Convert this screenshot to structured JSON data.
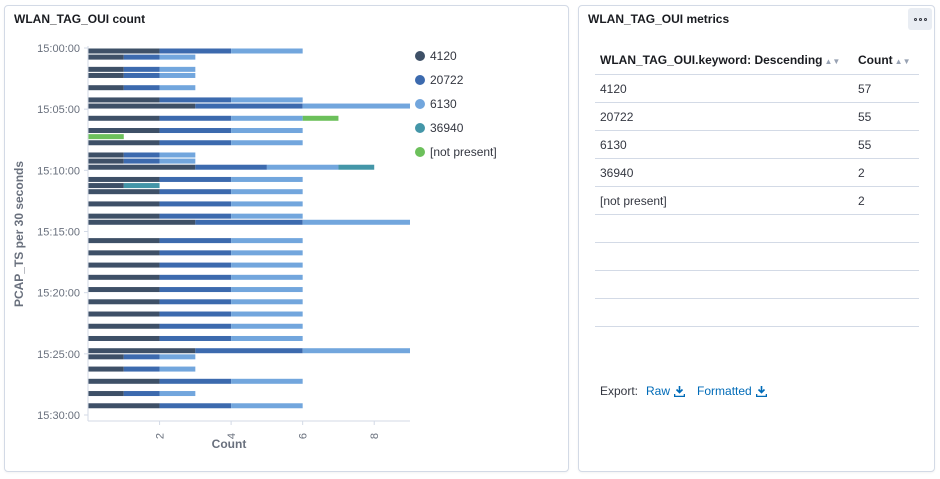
{
  "chart_panel": {
    "title": "WLAN_TAG_OUI count"
  },
  "metrics_panel": {
    "title": "WLAN_TAG_OUI metrics",
    "columns": [
      "WLAN_TAG_OUI.keyword: Descending",
      "Count"
    ],
    "rows": [
      [
        "4120",
        "57"
      ],
      [
        "20722",
        "55"
      ],
      [
        "6130",
        "55"
      ],
      [
        "36940",
        "2"
      ],
      [
        "[not present]",
        "2"
      ],
      [
        "",
        ""
      ],
      [
        "",
        ""
      ],
      [
        "",
        ""
      ],
      [
        "",
        ""
      ]
    ],
    "export_label": "Export:",
    "export_raw": "Raw",
    "export_formatted": "Formatted"
  },
  "colors": {
    "4120": "#3e5067",
    "20722": "#3c6aae",
    "6130": "#72a6dd",
    "36940": "#4496a8",
    "[not present]": "#6cc05b",
    "link": "#006bb8"
  },
  "chart_data": {
    "type": "bar",
    "orientation": "horizontal",
    "stacked": true,
    "xlabel": "Count",
    "ylabel": "PCAP_TS per 30 seconds",
    "xlim": [
      0,
      9
    ],
    "xticks": [
      "2",
      "4",
      "6",
      "8"
    ],
    "yticks": [
      "15:00:00",
      "15:05:00",
      "15:10:00",
      "15:15:00",
      "15:20:00",
      "15:25:00",
      "15:30:00"
    ],
    "legend": {
      "position": "right",
      "items": [
        "4120",
        "20722",
        "6130",
        "36940",
        "[not present]"
      ]
    },
    "grid": false,
    "series_order": [
      "4120",
      "20722",
      "6130",
      "36940",
      "[not present]"
    ],
    "bars": [
      {
        "t": "15:00:00",
        "values": [
          2,
          2,
          2,
          0,
          0
        ]
      },
      {
        "t": "15:00:30",
        "values": [
          1,
          1,
          1,
          0,
          0
        ]
      },
      {
        "t": "15:01:30",
        "values": [
          1,
          1,
          1,
          0,
          0
        ]
      },
      {
        "t": "15:02:00",
        "values": [
          1,
          1,
          1,
          0,
          0
        ]
      },
      {
        "t": "15:03:00",
        "values": [
          1,
          1,
          1,
          0,
          0
        ]
      },
      {
        "t": "15:04:00",
        "values": [
          2,
          2,
          2,
          0,
          0
        ]
      },
      {
        "t": "15:04:30",
        "values": [
          3,
          3,
          3,
          0,
          0
        ]
      },
      {
        "t": "15:05:30",
        "values": [
          2,
          2,
          2,
          0,
          1
        ]
      },
      {
        "t": "15:06:30",
        "values": [
          2,
          2,
          2,
          0,
          0
        ]
      },
      {
        "t": "15:07:00",
        "values": [
          0,
          0,
          0,
          0,
          1
        ]
      },
      {
        "t": "15:07:30",
        "values": [
          2,
          2,
          2,
          0,
          0
        ]
      },
      {
        "t": "15:08:30",
        "values": [
          1,
          1,
          1,
          0,
          0
        ]
      },
      {
        "t": "15:09:00",
        "values": [
          1,
          1,
          1,
          0,
          0
        ]
      },
      {
        "t": "15:09:30",
        "values": [
          3,
          2,
          2,
          1,
          0
        ]
      },
      {
        "t": "15:10:30",
        "values": [
          2,
          2,
          2,
          0,
          0
        ]
      },
      {
        "t": "15:11:00",
        "values": [
          1,
          0,
          0,
          1,
          0
        ]
      },
      {
        "t": "15:11:30",
        "values": [
          2,
          2,
          2,
          0,
          0
        ]
      },
      {
        "t": "15:12:30",
        "values": [
          2,
          2,
          2,
          0,
          0
        ]
      },
      {
        "t": "15:13:30",
        "values": [
          2,
          2,
          2,
          0,
          0
        ]
      },
      {
        "t": "15:14:00",
        "values": [
          3,
          3,
          3,
          0,
          0
        ]
      },
      {
        "t": "15:15:30",
        "values": [
          2,
          2,
          2,
          0,
          0
        ]
      },
      {
        "t": "15:16:30",
        "values": [
          2,
          2,
          2,
          0,
          0
        ]
      },
      {
        "t": "15:17:30",
        "values": [
          2,
          2,
          2,
          0,
          0
        ]
      },
      {
        "t": "15:18:30",
        "values": [
          2,
          2,
          2,
          0,
          0
        ]
      },
      {
        "t": "15:19:30",
        "values": [
          2,
          2,
          2,
          0,
          0
        ]
      },
      {
        "t": "15:20:30",
        "values": [
          2,
          2,
          2,
          0,
          0
        ]
      },
      {
        "t": "15:21:30",
        "values": [
          2,
          2,
          2,
          0,
          0
        ]
      },
      {
        "t": "15:22:30",
        "values": [
          2,
          2,
          2,
          0,
          0
        ]
      },
      {
        "t": "15:23:30",
        "values": [
          2,
          2,
          2,
          0,
          0
        ]
      },
      {
        "t": "15:24:30",
        "values": [
          3,
          3,
          3,
          0,
          0
        ]
      },
      {
        "t": "15:25:00",
        "values": [
          1,
          1,
          1,
          0,
          0
        ]
      },
      {
        "t": "15:26:00",
        "values": [
          1,
          1,
          1,
          0,
          0
        ]
      },
      {
        "t": "15:27:00",
        "values": [
          2,
          2,
          2,
          0,
          0
        ]
      },
      {
        "t": "15:28:00",
        "values": [
          1,
          1,
          1,
          0,
          0
        ]
      },
      {
        "t": "15:29:00",
        "values": [
          2,
          2,
          2,
          0,
          0
        ]
      }
    ]
  }
}
